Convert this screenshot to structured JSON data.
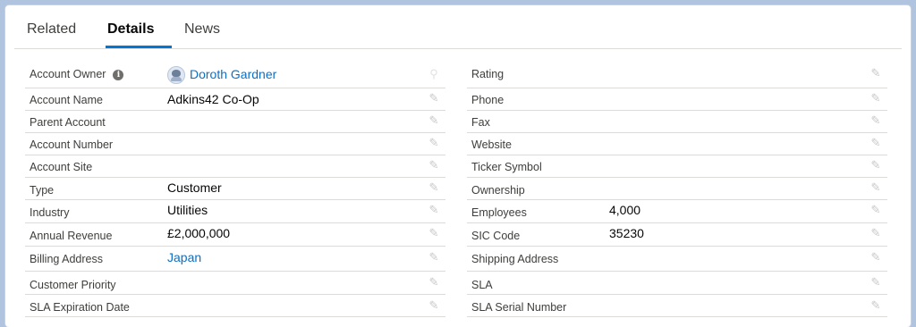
{
  "tabs": [
    {
      "label": "Related"
    },
    {
      "label": "Details"
    },
    {
      "label": "News"
    }
  ],
  "active_tab": "Details",
  "details_left": [
    {
      "label": "Account Owner",
      "value": "Doroth Gardner"
    },
    {
      "label": "Account Name",
      "value": "Adkins42 Co-Op"
    },
    {
      "label": "Parent Account",
      "value": ""
    },
    {
      "label": "Account Number",
      "value": ""
    },
    {
      "label": "Account Site",
      "value": ""
    },
    {
      "label": "Type",
      "value": "Customer"
    },
    {
      "label": "Industry",
      "value": "Utilities"
    },
    {
      "label": "Annual Revenue",
      "value": "£2,000,000"
    },
    {
      "label": "Billing Address",
      "value": "Japan"
    },
    {
      "label": "Customer Priority",
      "value": ""
    },
    {
      "label": "SLA Expiration Date",
      "value": ""
    }
  ],
  "details_right": [
    {
      "label": "Rating",
      "value": ""
    },
    {
      "label": "Phone",
      "value": ""
    },
    {
      "label": "Fax",
      "value": ""
    },
    {
      "label": "Website",
      "value": ""
    },
    {
      "label": "Ticker Symbol",
      "value": ""
    },
    {
      "label": "Ownership",
      "value": ""
    },
    {
      "label": "Employees",
      "value": "4,000"
    },
    {
      "label": "SIC Code",
      "value": "35230"
    },
    {
      "label": "Shipping Address",
      "value": ""
    },
    {
      "label": "SLA",
      "value": ""
    },
    {
      "label": "SLA Serial Number",
      "value": ""
    }
  ],
  "icons": {
    "info": "info-icon",
    "edit": "pencil-edit-icon",
    "avatar": "user-avatar-icon"
  },
  "colors": {
    "accent": "#0176d3",
    "link": "#0b6fc6",
    "background": "#b0c4df"
  }
}
